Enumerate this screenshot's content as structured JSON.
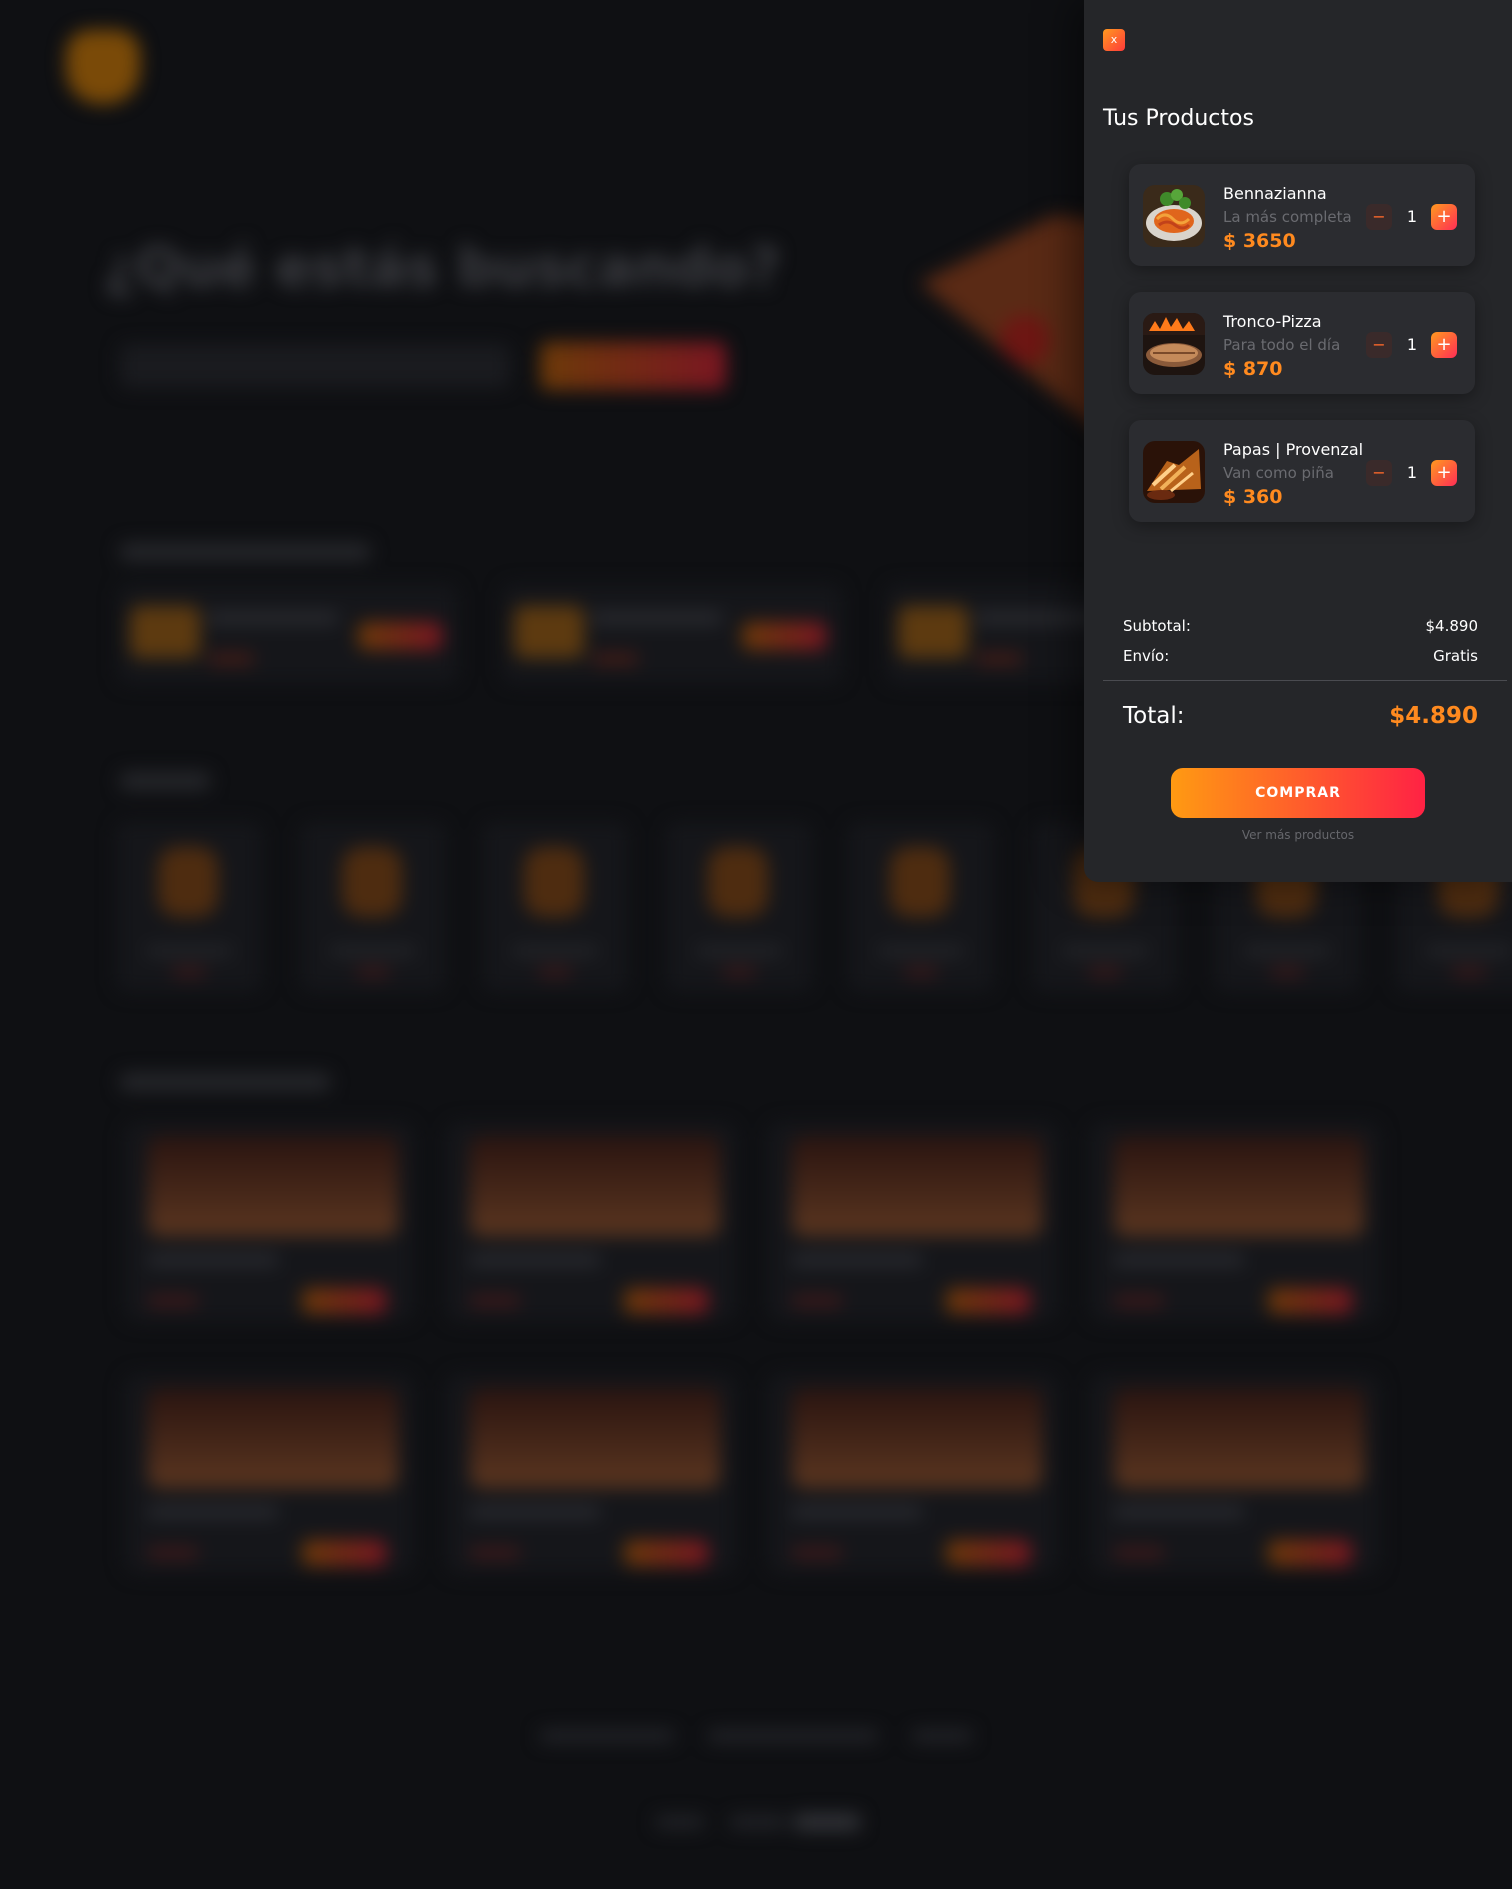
{
  "background_page": {
    "heading": "¿Qué estás buscando?"
  },
  "cart": {
    "close_label": "x",
    "title": "Tus Productos",
    "items": [
      {
        "name": "Bennazianna",
        "description": "La más completa",
        "price": "$ 3650",
        "quantity": "1",
        "image_icon": "pasta-dish-icon"
      },
      {
        "name": "Tronco-Pizza",
        "description": "Para todo el día",
        "price": "$ 870",
        "quantity": "1",
        "image_icon": "pizza-oven-icon"
      },
      {
        "name": "Papas | Provenzal",
        "description": "Van como piña",
        "price": "$ 360",
        "quantity": "1",
        "image_icon": "fries-icon"
      }
    ],
    "minus_symbol": "−",
    "plus_symbol": "+",
    "subtotal_label": "Subtotal:",
    "subtotal_value": "$4.890",
    "shipping_label": "Envío:",
    "shipping_value": "Gratis",
    "total_label": "Total:",
    "total_value": "$4.890",
    "buy_button": "COMPRAR",
    "more_link": "Ver más productos"
  },
  "colors": {
    "accent_start": "#ff9a12",
    "accent_end": "#ff2244",
    "price_orange": "#ff8a1f",
    "drawer_bg": "#252629",
    "page_bg": "#0f1013"
  }
}
